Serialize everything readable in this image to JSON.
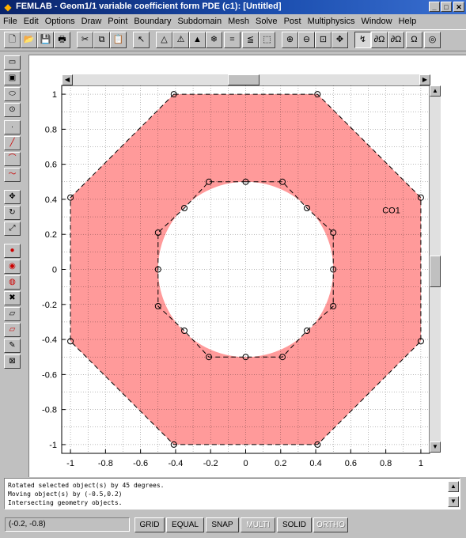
{
  "window": {
    "title": "FEMLAB - Geom1/1 variable coefficient form PDE (c1): [Untitled]",
    "controls": {
      "minimize": "_",
      "maximize": "□",
      "close": "✕"
    }
  },
  "menu": [
    "File",
    "Edit",
    "Options",
    "Draw",
    "Point",
    "Boundary",
    "Subdomain",
    "Mesh",
    "Solve",
    "Post",
    "Multiphysics",
    "Window",
    "Help"
  ],
  "toolbar": {
    "buttons": [
      {
        "name": "new-icon",
        "glyph": "🗋"
      },
      {
        "name": "open-icon",
        "glyph": "📂"
      },
      {
        "name": "save-icon",
        "glyph": "💾"
      },
      {
        "name": "print-icon",
        "glyph": "🖶"
      },
      {
        "name": "cut-icon",
        "glyph": "✂"
      },
      {
        "name": "copy-icon",
        "glyph": "⧉"
      },
      {
        "name": "paste-icon",
        "glyph": "📋"
      },
      {
        "name": "pointer-icon",
        "glyph": "↖"
      },
      {
        "name": "draw-mode-icon",
        "glyph": "△"
      },
      {
        "name": "point-mode-icon",
        "glyph": "⚠"
      },
      {
        "name": "boundary-mode-icon",
        "glyph": "▲"
      },
      {
        "name": "subdomain-mode-icon",
        "glyph": "❄"
      },
      {
        "name": "equal-icon",
        "glyph": "="
      },
      {
        "name": "boundary-settings-icon",
        "glyph": "≦"
      },
      {
        "name": "mesh-icon",
        "glyph": "⬚"
      },
      {
        "name": "zoom-in-icon",
        "glyph": "⊕"
      },
      {
        "name": "zoom-out-icon",
        "glyph": "⊖"
      },
      {
        "name": "zoom-window-icon",
        "glyph": "⊡"
      },
      {
        "name": "zoom-extents-icon",
        "glyph": "✥"
      },
      {
        "name": "plot-icon",
        "glyph": "↯"
      },
      {
        "name": "subdomain-eq-icon",
        "glyph": "∂Ω"
      },
      {
        "name": "boundary-eq-icon",
        "glyph": "∂Ω"
      },
      {
        "name": "omega-icon",
        "glyph": "Ω"
      },
      {
        "name": "settings-icon",
        "glyph": "◎"
      }
    ]
  },
  "left_toolbar": [
    {
      "name": "rectangle-icon",
      "glyph": "▭"
    },
    {
      "name": "rectangle-center-icon",
      "glyph": "▣"
    },
    {
      "name": "ellipse-icon",
      "glyph": "⬭"
    },
    {
      "name": "ellipse-center-icon",
      "glyph": "⊙"
    },
    {
      "name": "point-icon",
      "glyph": "·"
    },
    {
      "name": "line-icon",
      "glyph": "╱"
    },
    {
      "name": "curve-icon",
      "glyph": "⌒"
    },
    {
      "name": "polyline-icon",
      "glyph": "〜"
    },
    {
      "name": "move-icon",
      "glyph": "✥"
    },
    {
      "name": "rotate-icon",
      "glyph": "↻"
    },
    {
      "name": "scale-icon",
      "glyph": "⤢"
    },
    {
      "name": "union-icon",
      "glyph": "●"
    },
    {
      "name": "intersection-icon",
      "glyph": "◉"
    },
    {
      "name": "difference-icon",
      "glyph": "◍"
    },
    {
      "name": "delete-objects-icon",
      "glyph": "✖"
    },
    {
      "name": "coerce-solid-icon",
      "glyph": "▱"
    },
    {
      "name": "coerce-curve-icon",
      "glyph": "▱"
    },
    {
      "name": "pencil-icon",
      "glyph": "✎"
    },
    {
      "name": "split-icon",
      "glyph": "⊠"
    }
  ],
  "colors": {
    "object_fill": "#ff9a9a",
    "grid": "#000000",
    "background": "#ffffff"
  },
  "plot": {
    "x_ticks": [
      "-1",
      "-0.8",
      "-0.6",
      "-0.4",
      "-0.2",
      "0",
      "0.2",
      "0.4",
      "0.6",
      "0.8",
      "1"
    ],
    "y_ticks": [
      "1",
      "0.8",
      "0.6",
      "0.4",
      "0.2",
      "0",
      "-0.2",
      "-0.4",
      "-0.6",
      "-0.8",
      "-1"
    ],
    "xlim": [
      -1.05,
      1.05
    ],
    "ylim": [
      -1.05,
      1.05
    ],
    "object_label": "CO1",
    "object_label_position": [
      0.78,
      0.32
    ],
    "outer_octagon": [
      [
        -0.41,
        1
      ],
      [
        0.41,
        1
      ],
      [
        1,
        0.41
      ],
      [
        1,
        -0.41
      ],
      [
        0.41,
        -1
      ],
      [
        -0.41,
        -1
      ],
      [
        -1,
        -0.41
      ],
      [
        -1,
        0.41
      ]
    ],
    "inner_circle_radius": 0.5,
    "inner_control_polygon": [
      [
        0,
        0.5
      ],
      [
        0.21,
        0.5
      ],
      [
        0.35,
        0.35
      ],
      [
        0.5,
        0.21
      ],
      [
        0.5,
        0
      ],
      [
        0.5,
        -0.21
      ],
      [
        0.35,
        -0.35
      ],
      [
        0.21,
        -0.5
      ],
      [
        0,
        -0.5
      ],
      [
        -0.21,
        -0.5
      ],
      [
        -0.35,
        -0.35
      ],
      [
        -0.5,
        -0.21
      ],
      [
        -0.5,
        0
      ],
      [
        -0.5,
        0.21
      ],
      [
        -0.35,
        0.35
      ],
      [
        -0.21,
        0.5
      ]
    ]
  },
  "log": [
    "Rotated selected object(s) by 45 degrees.",
    "Moving object(s) by (-0.5,0.2)",
    "Intersecting geometry objects."
  ],
  "status": {
    "coords": "(-0.2, -0.8)",
    "buttons": [
      {
        "label": "GRID",
        "enabled": true
      },
      {
        "label": "EQUAL",
        "enabled": true
      },
      {
        "label": "SNAP",
        "enabled": true
      },
      {
        "label": "MULTI",
        "enabled": false
      },
      {
        "label": "SOLID",
        "enabled": true
      },
      {
        "label": "ORTHO",
        "enabled": false
      }
    ]
  }
}
